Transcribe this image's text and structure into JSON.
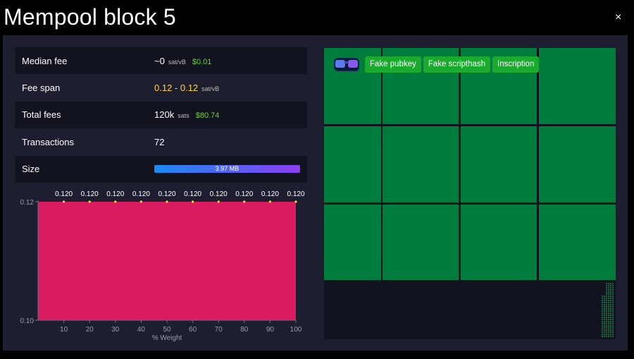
{
  "header": {
    "title": "Mempool block 5",
    "close_label": "×"
  },
  "stats": {
    "median_fee": {
      "label": "Median fee",
      "value": "~0",
      "unit": "sat/vB",
      "usd": "$0.01"
    },
    "fee_span": {
      "label": "Fee span",
      "value": "0.12 - 0.12",
      "unit": "sat/vB"
    },
    "total_fees": {
      "label": "Total fees",
      "value": "120k",
      "unit": "sats",
      "usd": "$80.74"
    },
    "transactions": {
      "label": "Transactions",
      "value": "72"
    },
    "size": {
      "label": "Size",
      "value": "3.97 MB",
      "fill_fraction": 1.0
    }
  },
  "chart_data": {
    "type": "area",
    "xlabel": "% Weight",
    "x": [
      10,
      20,
      30,
      40,
      50,
      60,
      70,
      80,
      90,
      100
    ],
    "series": [
      {
        "values": [
          0.12,
          0.12,
          0.12,
          0.12,
          0.12,
          0.12,
          0.12,
          0.12,
          0.12,
          0.12
        ]
      }
    ],
    "data_labels": [
      "0.120",
      "0.120",
      "0.120",
      "0.120",
      "0.120",
      "0.120",
      "0.120",
      "0.120",
      "0.120",
      "0.120"
    ],
    "yticks": [
      "0.12",
      "0.10"
    ],
    "ylim": [
      0.1,
      0.12
    ],
    "xlim": [
      0,
      100
    ],
    "fill_color": "#da1b60",
    "marker_color": "#ffd53d",
    "grid": false
  },
  "block_tags": [
    "Fake pubkey",
    "Fake scripthash",
    "Inscription"
  ],
  "block_icon": "glasses-icon",
  "colors": {
    "tx_tile": "#007d3c",
    "tag": "#1aaa2e",
    "panel": "#1d1f31"
  }
}
